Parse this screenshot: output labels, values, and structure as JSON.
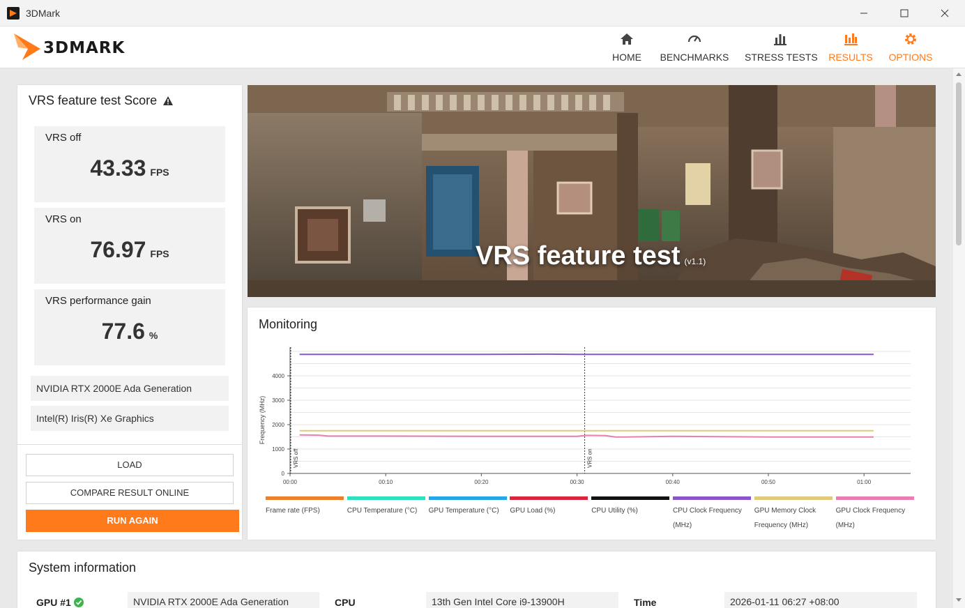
{
  "window": {
    "title": "3DMark"
  },
  "logo": {
    "text": "3DMARK"
  },
  "nav": [
    {
      "label": "HOME",
      "icon": "home-icon"
    },
    {
      "label": "BENCHMARKS",
      "icon": "gauge-icon"
    },
    {
      "label": "STRESS TESTS",
      "icon": "bars-icon"
    },
    {
      "label": "RESULTS",
      "icon": "results-icon",
      "active": true
    },
    {
      "label": "OPTIONS",
      "icon": "gear-icon",
      "active": true
    }
  ],
  "score": {
    "title": "VRS feature test Score",
    "cards": [
      {
        "label": "VRS off",
        "value": "43.33",
        "unit": "FPS"
      },
      {
        "label": "VRS on",
        "value": "76.97",
        "unit": "FPS"
      },
      {
        "label": "VRS performance gain",
        "value": "77.6",
        "unit": "%"
      }
    ],
    "gpus": [
      "NVIDIA RTX 2000E Ada Generation",
      "Intel(R) Iris(R) Xe Graphics"
    ],
    "buttons": {
      "load": "LOAD",
      "compare": "COMPARE RESULT ONLINE",
      "run_again": "RUN AGAIN"
    }
  },
  "hero": {
    "title": "VRS feature test",
    "version": "(v1.1)"
  },
  "monitoring": {
    "title": "Monitoring",
    "legend": [
      {
        "label": "Frame rate (FPS)",
        "color": "#f07e26"
      },
      {
        "label": "CPU Temperature (°C)",
        "color": "#2de0c0"
      },
      {
        "label": "GPU Temperature (°C)",
        "color": "#23a7e8"
      },
      {
        "label": "GPU Load (%)",
        "color": "#d8263a"
      },
      {
        "label": "CPU Utility (%)",
        "color": "#111111"
      },
      {
        "label": "CPU Clock Frequency (MHz)",
        "color": "#8a55c8"
      },
      {
        "label": "GPU Memory Clock Frequency (MHz)",
        "color": "#e0c97a"
      },
      {
        "label": "GPU Clock Frequency (MHz)",
        "color": "#e87fb0"
      }
    ]
  },
  "chart_data": {
    "type": "line",
    "ylabel": "Frequency (MHz)",
    "xlabel": "",
    "ylim": [
      0,
      5000
    ],
    "xlim": [
      0,
      65
    ],
    "yticks": [
      0,
      1000,
      2000,
      3000,
      4000
    ],
    "ytick_labels": [
      "0",
      "1000",
      "2000",
      "3000",
      "4000"
    ],
    "xticks": [
      0,
      10,
      20,
      30,
      40,
      50,
      60
    ],
    "xtick_labels": [
      "00:00",
      "00:10",
      "00:20",
      "00:30",
      "00:40",
      "00:50",
      "01:00"
    ],
    "markers": [
      {
        "label": "VRS off",
        "x": 0
      },
      {
        "label": "VRS on",
        "x": 30.8
      }
    ],
    "grid": true,
    "series": [
      {
        "name": "CPU Clock Frequency (MHz)",
        "color": "#8a55c8",
        "x": [
          1,
          10,
          20,
          27,
          30,
          35,
          40,
          50,
          60,
          61
        ],
        "y": [
          4880,
          4880,
          4880,
          4890,
          4880,
          4880,
          4880,
          4880,
          4880,
          4880
        ]
      },
      {
        "name": "GPU Memory Clock Frequency (MHz)",
        "color": "#e0c97a",
        "x": [
          1,
          10,
          20,
          30,
          40,
          50,
          60,
          61
        ],
        "y": [
          1750,
          1750,
          1750,
          1750,
          1750,
          1750,
          1750,
          1750
        ]
      },
      {
        "name": "GPU Clock Frequency (MHz)",
        "color": "#e87fb0",
        "x": [
          1,
          3,
          4,
          10,
          20,
          30,
          31,
          33,
          34,
          35,
          40,
          45,
          50,
          60,
          61
        ],
        "y": [
          1580,
          1570,
          1530,
          1530,
          1520,
          1520,
          1560,
          1550,
          1490,
          1490,
          1520,
          1510,
          1490,
          1490,
          1490
        ]
      }
    ]
  },
  "sysinfo": {
    "title": "System information",
    "gpu_label": "GPU #1",
    "gpu_value": "NVIDIA RTX 2000E Ada Generation",
    "cpu_label": "CPU",
    "cpu_value": "13th Gen Intel Core i9-13900H",
    "time_label": "Time",
    "time_value": "2026-01-11 06:27 +08:00"
  }
}
